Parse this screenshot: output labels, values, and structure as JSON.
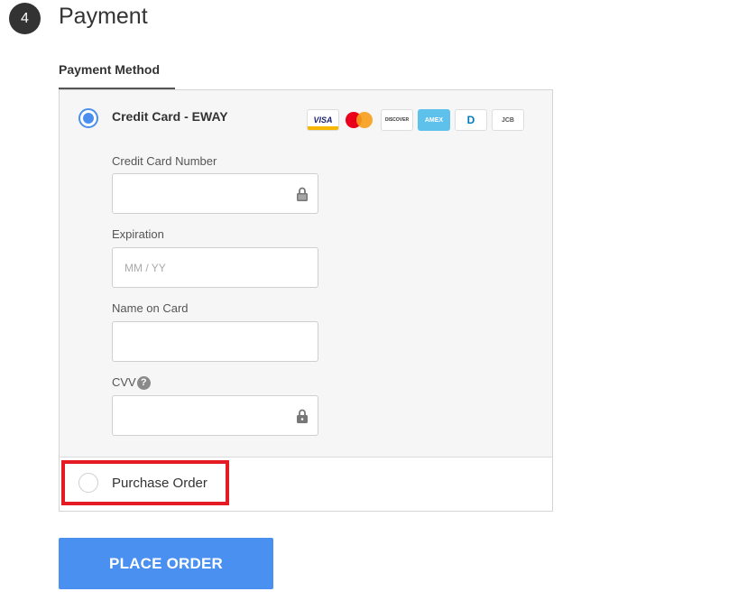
{
  "step": {
    "number": "4",
    "title": "Payment"
  },
  "payment_method": {
    "label": "Payment Method"
  },
  "credit_card": {
    "option_label": "Credit Card - EWAY",
    "selected": true,
    "card_logos": [
      {
        "name": "visa-logo",
        "text": "VISA"
      },
      {
        "name": "mastercard-logo",
        "text": ""
      },
      {
        "name": "discover-logo",
        "text": "DISCOVER"
      },
      {
        "name": "amex-logo",
        "text": "AMEX"
      },
      {
        "name": "diners-logo",
        "text": "D"
      },
      {
        "name": "jcb-logo",
        "text": "JCB"
      }
    ],
    "fields": {
      "card_number": {
        "label": "Credit Card Number",
        "value": "",
        "placeholder": ""
      },
      "expiration": {
        "label": "Expiration",
        "value": "",
        "placeholder": "MM / YY"
      },
      "name_on_card": {
        "label": "Name on Card",
        "value": "",
        "placeholder": ""
      },
      "cvv": {
        "label": "CVV",
        "value": "",
        "placeholder": "",
        "help_glyph": "?"
      }
    }
  },
  "purchase_order": {
    "option_label": "Purchase Order",
    "selected": false
  },
  "actions": {
    "place_order_label": "PLACE ORDER"
  },
  "colors": {
    "accent": "#4a90f0",
    "highlight": "#e51b23",
    "step_badge": "#333333"
  }
}
